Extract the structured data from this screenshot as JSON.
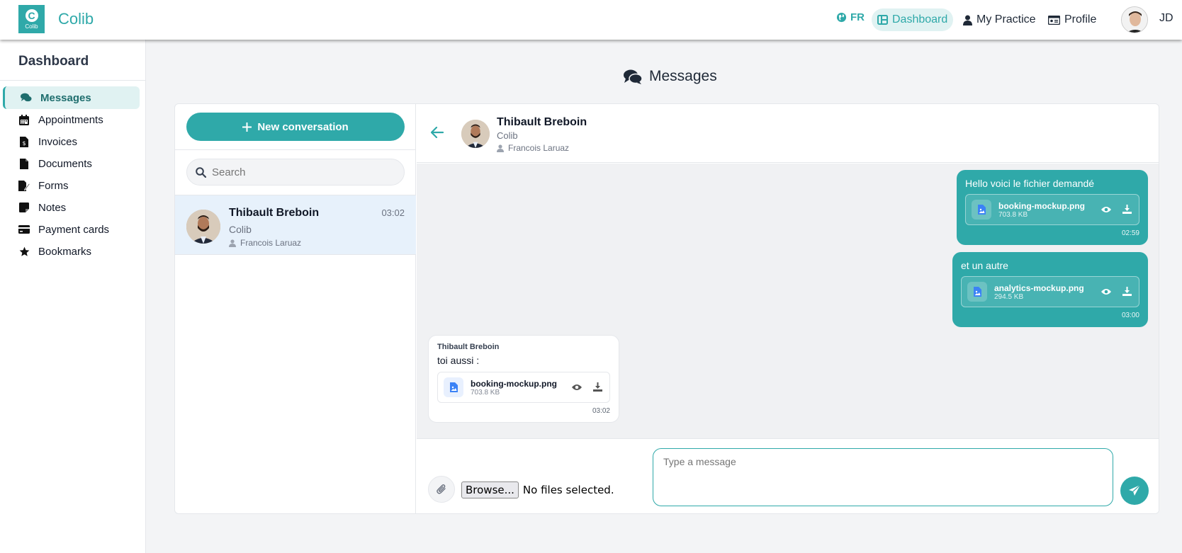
{
  "app": {
    "brand": "Colib",
    "logo_text": "Colib",
    "logo_letter": "C"
  },
  "nav": {
    "lang": "FR",
    "items": [
      {
        "label": "Dashboard",
        "icon": "dashboard-icon",
        "active": true
      },
      {
        "label": "My Practice",
        "icon": "practitioner-icon",
        "active": false
      },
      {
        "label": "Profile",
        "icon": "id-card-icon",
        "active": false
      }
    ],
    "user_initials": "JD"
  },
  "sidebar": {
    "title": "Dashboard",
    "items": [
      {
        "label": "Messages",
        "icon": "comments-icon",
        "active": true
      },
      {
        "label": "Appointments",
        "icon": "calendar-icon",
        "active": false
      },
      {
        "label": "Invoices",
        "icon": "invoice-icon",
        "active": false
      },
      {
        "label": "Documents",
        "icon": "document-icon",
        "active": false
      },
      {
        "label": "Forms",
        "icon": "form-icon",
        "active": false
      },
      {
        "label": "Notes",
        "icon": "note-icon",
        "active": false
      },
      {
        "label": "Payment cards",
        "icon": "credit-card-icon",
        "active": false
      },
      {
        "label": "Bookmarks",
        "icon": "star-icon",
        "active": false
      }
    ]
  },
  "page": {
    "title": "Messages"
  },
  "conversations": {
    "new_label": "New conversation",
    "search_placeholder": "Search",
    "items": [
      {
        "name": "Thibault Breboin",
        "org": "Colib",
        "person": "Francois Laruaz",
        "time": "03:02",
        "selected": true
      }
    ]
  },
  "chat": {
    "header": {
      "name": "Thibault Breboin",
      "org": "Colib",
      "person": "Francois Laruaz"
    },
    "messages": [
      {
        "direction": "out",
        "text": "Hello voici le fichier demandé",
        "file_name": "booking-mockup.png",
        "file_size": "703.8 KB",
        "time": "02:59"
      },
      {
        "direction": "out",
        "text": "et un autre",
        "file_name": "analytics-mockup.png",
        "file_size": "294.5 KB",
        "time": "03:00"
      },
      {
        "direction": "in",
        "sender": "Thibault Breboin",
        "text": "toi aussi :",
        "file_name": "booking-mockup.png",
        "file_size": "703.8 KB",
        "time": "03:02"
      }
    ],
    "composer": {
      "placeholder": "Type a message",
      "browse_label": "Browse...",
      "no_files_label": "No files selected."
    }
  },
  "colors": {
    "accent": "#2fa9a9",
    "selected_row": "#e7f1fb",
    "file_icon": "#3b82f6"
  }
}
